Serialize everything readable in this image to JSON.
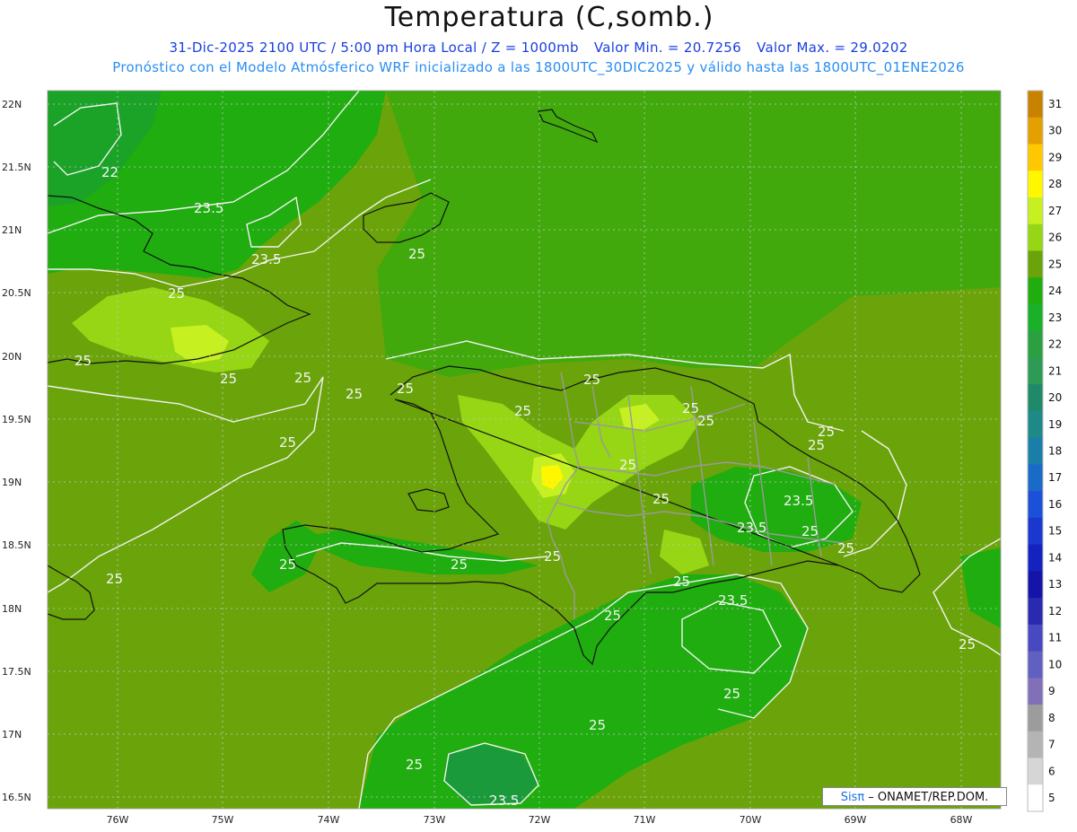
{
  "header": {
    "title": "Temperatura (C,somb.)",
    "datetime": "31-Dic-2025  2100 UTC / 5:00 pm Hora Local / Z = 1000mb",
    "valor_min": "Valor Min. = 20.7256",
    "valor_max": "Valor Max. = 29.0202",
    "model_info": "Pronóstico con el Modelo Atmósferico WRF inicializado a las 1800UTC_30DIC2025 y válido hasta las  1800UTC_01ENE2026"
  },
  "map": {
    "lat_labels": [
      "22N",
      "21.5N",
      "21N",
      "20.5N",
      "20N",
      "19.5N",
      "19N",
      "18.5N",
      "18N",
      "17.5N",
      "17N",
      "16.5N"
    ],
    "lon_labels": [
      "76W",
      "75W",
      "74W",
      "73W",
      "72W",
      "71W",
      "70W",
      "69W",
      "68W"
    ],
    "contour_labels": [
      "22",
      "23.5",
      "23.5",
      "25",
      "25",
      "25",
      "25",
      "25",
      "25",
      "25",
      "25",
      "25",
      "25",
      "25",
      "25",
      "25",
      "25",
      "25",
      "23.5",
      "23.5",
      "25",
      "25",
      "25",
      "23.5",
      "25",
      "25",
      "25",
      "25",
      "25",
      "23.5",
      "25"
    ],
    "background_color": "#6aa40a"
  },
  "colorbar": {
    "levels": [
      "31",
      "30",
      "29",
      "28",
      "27",
      "26",
      "25",
      "24",
      "23",
      "22",
      "21",
      "20",
      "19",
      "18",
      "17",
      "16",
      "15",
      "14",
      "13",
      "12",
      "11",
      "10",
      "9",
      "8",
      "7",
      "6",
      "5"
    ],
    "colors": [
      "#c98200",
      "#e3a000",
      "#ffc800",
      "#fff700",
      "#c6f020",
      "#96d614",
      "#6aa40a",
      "#1fad0f",
      "#1bb02a",
      "#2aa040",
      "#2d9a55",
      "#1f8a6a",
      "#1d8a88",
      "#1a7fa8",
      "#1a6ac8",
      "#1c50d8",
      "#1a38d0",
      "#1422c0",
      "#1414a8",
      "#2a2ab0",
      "#4848c0",
      "#6060c0",
      "#8070b8",
      "#9c9c9c",
      "#b4b4b4",
      "#d6d6d6",
      "#ffffff"
    ]
  },
  "footer": {
    "brand_sis": "Sisπ",
    "brand_org": " – ONAMET/REP.DOM."
  }
}
